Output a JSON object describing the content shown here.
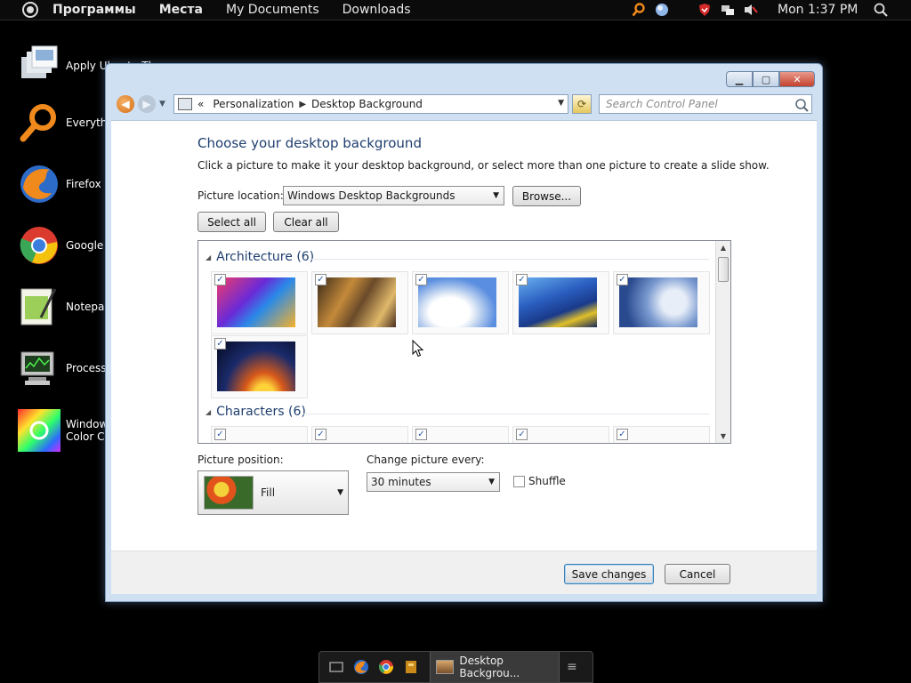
{
  "top_panel": {
    "menus": [
      "Программы",
      "Места",
      "My Documents",
      "Downloads"
    ],
    "clock": "Mon 1:37 PM"
  },
  "desktop_icons": [
    {
      "label": "Apply Ubuntu Theme"
    },
    {
      "label": "Everythi"
    },
    {
      "label": "Firefox"
    },
    {
      "label": "Google C"
    },
    {
      "label": "Notepac"
    },
    {
      "label": "Process"
    },
    {
      "label": "Window\nColor Ch"
    }
  ],
  "window": {
    "breadcrumb": {
      "prefix": "«",
      "items": [
        "Personalization",
        "Desktop Background"
      ]
    },
    "search_placeholder": "Search Control Panel",
    "heading": "Choose your desktop background",
    "subtext": "Click a picture to make it your desktop background, or select more than one picture to create a slide show.",
    "picture_location_label": "Picture location:",
    "picture_location_value": "Windows Desktop Backgrounds",
    "browse_label": "Browse...",
    "select_all_label": "Select all",
    "clear_all_label": "Clear all",
    "groups": [
      {
        "title": "Architecture (6)",
        "items": 6,
        "checked": true
      },
      {
        "title": "Characters (6)",
        "items": 5,
        "checked": true
      }
    ],
    "picture_position_label": "Picture position:",
    "picture_position_value": "Fill",
    "change_every_label": "Change picture every:",
    "change_every_value": "30 minutes",
    "shuffle_label": "Shuffle",
    "shuffle_checked": false,
    "save_label": "Save changes",
    "cancel_label": "Cancel"
  },
  "taskbar": {
    "active_task": "Desktop Backgrou..."
  },
  "colors": {
    "heading": "#1e3e6e",
    "window_frame": "#cfe0f3",
    "accent_orange": "#d26a10"
  }
}
